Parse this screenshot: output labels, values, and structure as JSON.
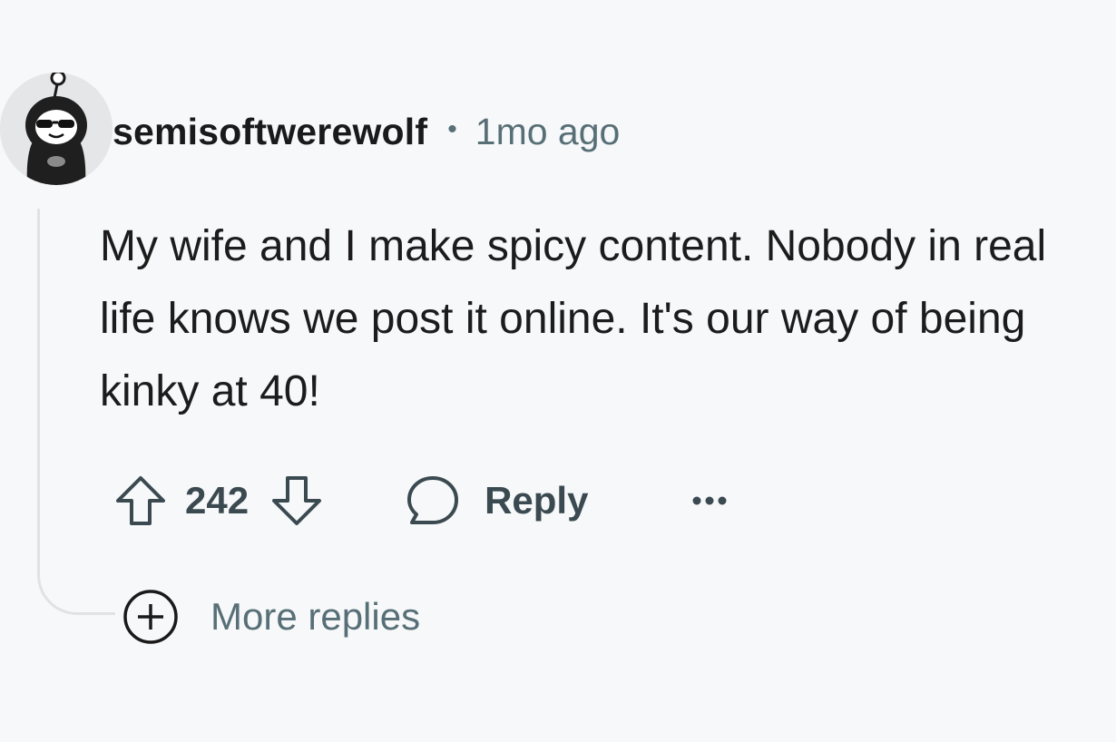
{
  "comment": {
    "author": "semisoftwerewolf",
    "separator": "•",
    "timestamp": "1mo ago",
    "body": "My wife and I make spicy content. Nobody in real life knows we post it online. It's our way of being kinky at 40!",
    "vote_count": "242",
    "reply_label": "Reply",
    "more_replies_label": "More replies",
    "icons": {
      "upvote": "arrow-up-outline-icon",
      "downvote": "arrow-down-outline-icon",
      "reply": "speech-bubble-icon",
      "overflow": "ellipsis-icon",
      "expand": "plus-circle-icon"
    }
  },
  "colors": {
    "background": "#f7f8fa",
    "text_primary": "#1c1c1c",
    "text_secondary": "#576f76",
    "action_text": "#3a4a50",
    "thread_line": "#dfe3e6"
  }
}
